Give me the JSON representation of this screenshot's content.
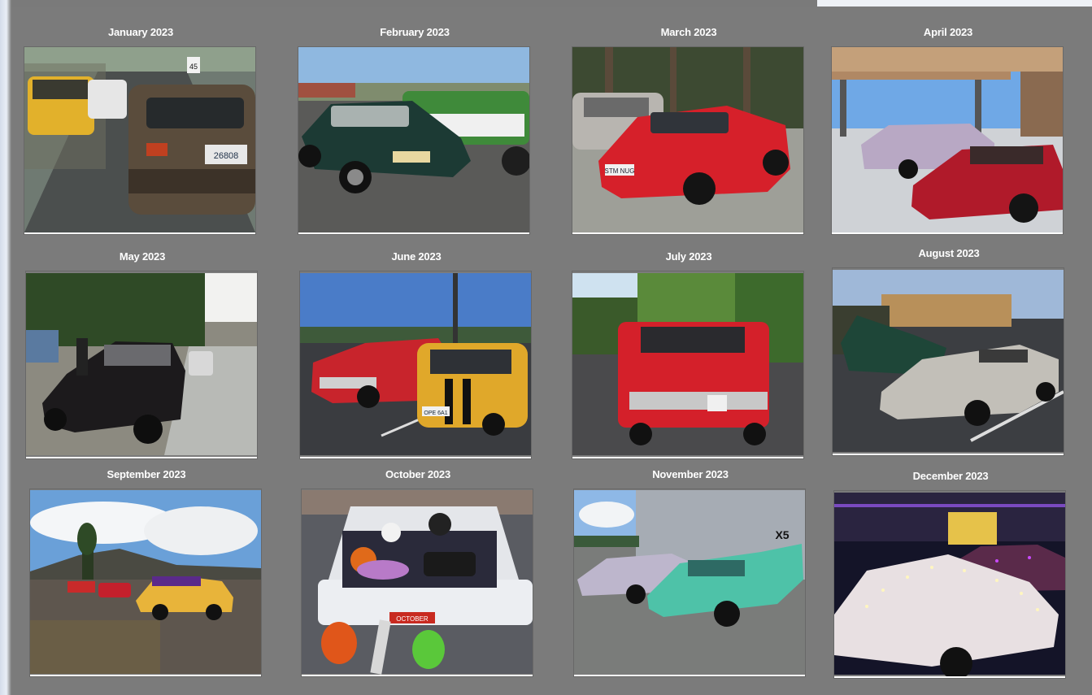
{
  "months": [
    {
      "label": "January 2023",
      "plate": "26808",
      "sign": "45"
    },
    {
      "label": "February 2023"
    },
    {
      "label": "March 2023",
      "plate": "STM NUG"
    },
    {
      "label": "April 2023"
    },
    {
      "label": "May 2023"
    },
    {
      "label": "June 2023",
      "plate": "OPE 6A1"
    },
    {
      "label": "July 2023"
    },
    {
      "label": "August 2023"
    },
    {
      "label": "September 2023"
    },
    {
      "label": "October 2023",
      "plate": "OCTOBER"
    },
    {
      "label": "November 2023",
      "sign": "X5"
    },
    {
      "label": "December 2023"
    }
  ]
}
